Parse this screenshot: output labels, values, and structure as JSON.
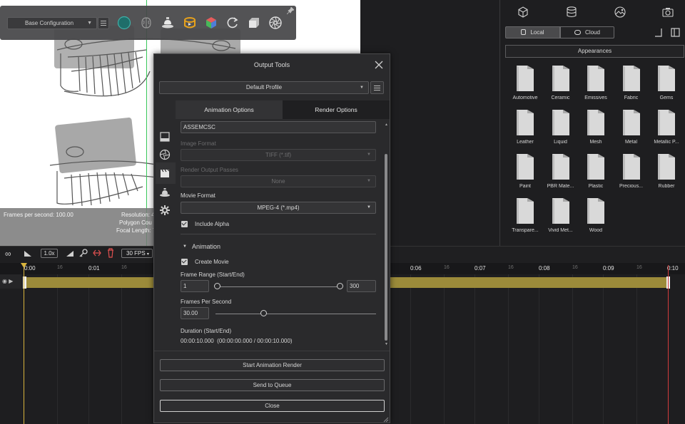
{
  "viewport": {
    "config_select": "Base Configuration",
    "hud_fps": "Frames per second: 100.00",
    "hud_resolution": "Resolution: 4",
    "hud_polygon": "Polygon Cou",
    "hud_focal": "Focal Length: 7"
  },
  "right_panel": {
    "segment_local": "Local",
    "segment_cloud": "Cloud",
    "appearances_button": "Appearances",
    "folders": [
      "Automotive",
      "Ceramic",
      "Emissives",
      "Fabric",
      "Gems",
      "Leather",
      "Liquid",
      "Mesh",
      "Metal",
      "Metallic P...",
      "Paint",
      "PBR Mate...",
      "Plastic",
      "Precious...",
      "Rubber",
      "Transpare...",
      "Vivid Met...",
      "Wood"
    ]
  },
  "timeline": {
    "speed": "1.0x",
    "fps": "30 FPS",
    "major_ticks": [
      "0:00",
      "0:01",
      "0:06",
      "0:07",
      "0:08",
      "0:09",
      "0:10"
    ],
    "minor_ticks": [
      "16",
      "16",
      "16",
      "16",
      "16",
      "16"
    ]
  },
  "dialog": {
    "title": "Output Tools",
    "profile": "Default Profile",
    "tab_animation": "Animation Options",
    "tab_render": "Render Options",
    "name_value": "ASSEMCSC",
    "image_format_label": "Image Format",
    "image_format_value": "TIFF (*.tif)",
    "passes_label": "Render Output Passes",
    "passes_value": "None",
    "movie_format_label": "Movie Format",
    "movie_format_value": "MPEG-4 (*.mp4)",
    "include_alpha": "Include Alpha",
    "animation_section": "Animation",
    "create_movie": "Create Movie",
    "frame_range_label": "Frame Range (Start/End)",
    "frame_start": "1",
    "frame_end": "300",
    "fps_label": "Frames Per Second",
    "fps_value": "30.00",
    "fps_fraction": 0.3,
    "duration_label": "Duration (Start/End)",
    "duration_value": "00:00:10.000",
    "duration_range": "(00:00:00.000 / 00:00:10.000)",
    "btn_start": "Start Animation Render",
    "btn_queue": "Send to Queue",
    "btn_close": "Close"
  }
}
